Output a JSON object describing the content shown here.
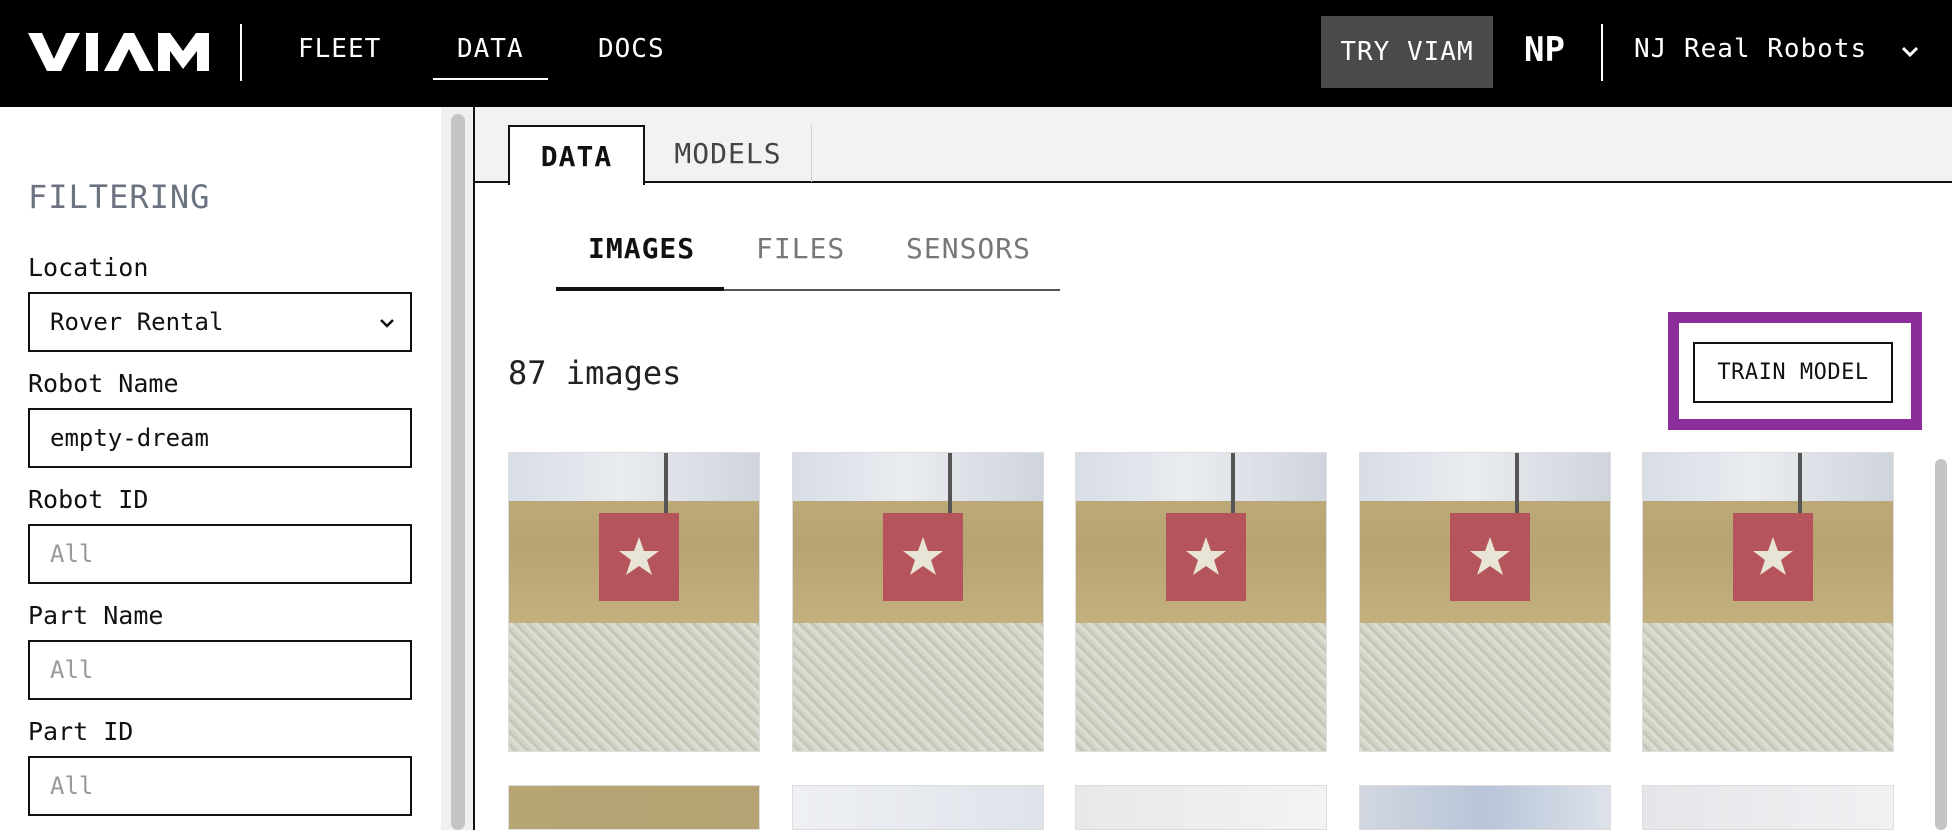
{
  "topbar": {
    "logo_text": "VIAM",
    "nav": [
      "FLEET",
      "DATA",
      "DOCS"
    ],
    "try_label": "TRY VIAM",
    "initials": "NP",
    "org_name": "NJ Real Robots"
  },
  "sidebar": {
    "title": "FILTERING",
    "fields": [
      {
        "label": "Location",
        "value": "Rover Rental"
      },
      {
        "label": "Robot Name",
        "value": "empty-dream"
      },
      {
        "label": "Robot ID",
        "placeholder": "All"
      },
      {
        "label": "Part Name",
        "placeholder": "All"
      },
      {
        "label": "Part ID",
        "placeholder": "All"
      }
    ]
  },
  "main": {
    "tabs": [
      "DATA",
      "MODELS"
    ],
    "subtabs": [
      "IMAGES",
      "FILES",
      "SENSORS"
    ],
    "count_text": "87 images",
    "train_label": "TRAIN MODEL"
  },
  "colors": {
    "highlight": "#8b2d9a",
    "topbar": "#000000",
    "try_button": "#4a4a4a"
  }
}
